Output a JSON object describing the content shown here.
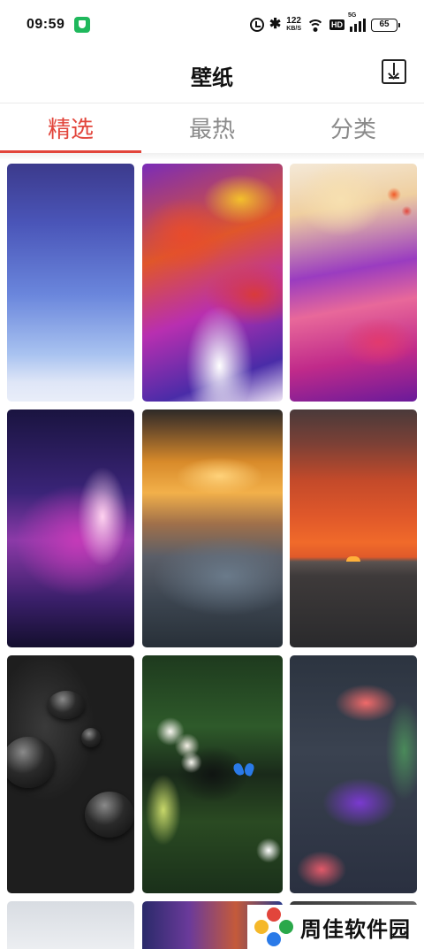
{
  "status_bar": {
    "time": "09:59",
    "speed_value": "122",
    "speed_unit": "KB/S",
    "hd_label": "HD",
    "network_label": "5G",
    "battery_level": "65",
    "icons": [
      "shield-icon",
      "alarm-icon",
      "bluetooth-icon",
      "wifi-icon",
      "signal-icon",
      "battery-icon"
    ]
  },
  "header": {
    "title": "壁纸",
    "download_icon": "download-icon"
  },
  "tabs": [
    {
      "label": "精选",
      "active": true
    },
    {
      "label": "最热",
      "active": false
    },
    {
      "label": "分类",
      "active": false
    }
  ],
  "colors": {
    "accent": "#e2453b",
    "tab_inactive": "#8a8a8a"
  },
  "wallpapers": [
    {
      "subject": "blue-purple gradient"
    },
    {
      "subject": "fluid paint swirl"
    },
    {
      "subject": "pastel fluid marble"
    },
    {
      "subject": "purple nebula burst"
    },
    {
      "subject": "golden sunlit clouds"
    },
    {
      "subject": "sunset over sea"
    },
    {
      "subject": "water drops on black"
    },
    {
      "subject": "white flowers and blue butterfly"
    },
    {
      "subject": "tropical bird of paradise flowers"
    },
    {
      "subject": "silver gradient"
    },
    {
      "subject": "colorful fluid"
    },
    {
      "subject": "dark gradient"
    }
  ],
  "watermark": {
    "text": "周佳软件园"
  }
}
